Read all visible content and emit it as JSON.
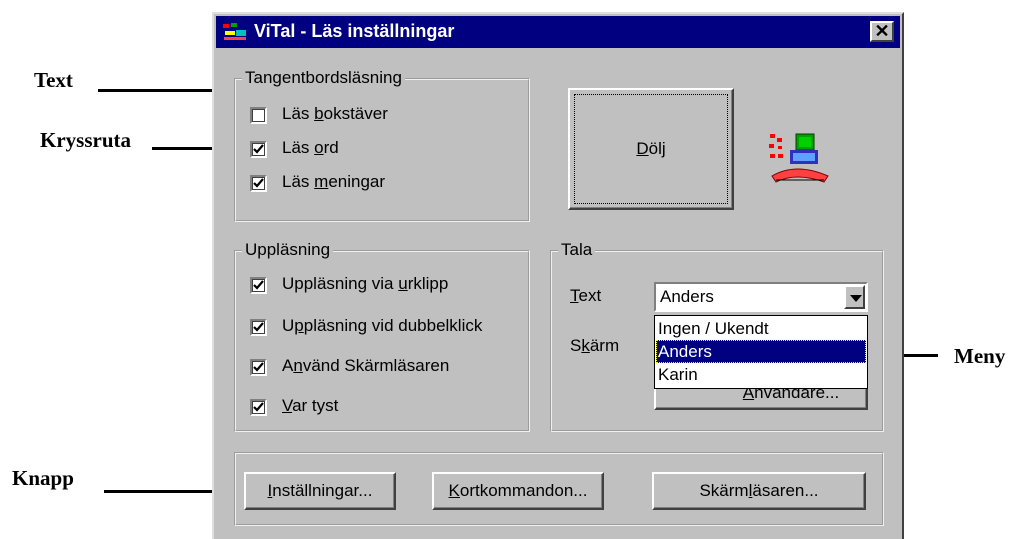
{
  "callouts": {
    "text": "Text",
    "checkbox": "Kryssruta",
    "menu": "Meny",
    "button": "Knapp"
  },
  "window": {
    "title": "ViTal - Läs inställningar",
    "close": "✕"
  },
  "keyboard_group": {
    "legend": "Tangentbordsläsning",
    "items": [
      {
        "pre": "Läs ",
        "u": "b",
        "post": "okstäver",
        "checked": false
      },
      {
        "pre": "Läs ",
        "u": "o",
        "post": "rd",
        "checked": true
      },
      {
        "pre": "Läs ",
        "u": "m",
        "post": "eningar",
        "checked": true
      }
    ]
  },
  "hide_button": {
    "pre": "",
    "u": "D",
    "post": "ölj"
  },
  "reading_group": {
    "legend": "Uppläsning",
    "items": [
      {
        "pre": "Uppläsning via ",
        "u": "u",
        "post": "rklipp",
        "checked": true
      },
      {
        "pre": "U",
        "u": "p",
        "post": "pläsning vid dubbelklick",
        "checked": true
      },
      {
        "pre": "A",
        "u": "n",
        "post": "vänd Skärmläsaren",
        "checked": true
      },
      {
        "pre": "",
        "u": "V",
        "post": "ar tyst",
        "checked": true
      }
    ]
  },
  "speak_group": {
    "legend": "Tala",
    "text_label": {
      "pre": "",
      "u": "T",
      "post": "ext"
    },
    "screen_label": {
      "pre": "S",
      "u": "k",
      "post": "ärm"
    },
    "combo_value": "Anders",
    "dropdown_options": [
      "Ingen / Ukendt",
      "Anders",
      "Karin"
    ],
    "selected_index": 1,
    "users_button": {
      "pre": "",
      "u": "A",
      "post": "nvändare..."
    }
  },
  "bottom_buttons": [
    {
      "pre": "",
      "u": "I",
      "post": "nställningar..."
    },
    {
      "pre": "",
      "u": "K",
      "post": "ortkommandon..."
    },
    {
      "pre": "Skärm",
      "u": "l",
      "post": "äsaren..."
    }
  ],
  "colors": {
    "titlebar": "#000080",
    "face": "#c0c0c0",
    "selection": "#000080"
  }
}
